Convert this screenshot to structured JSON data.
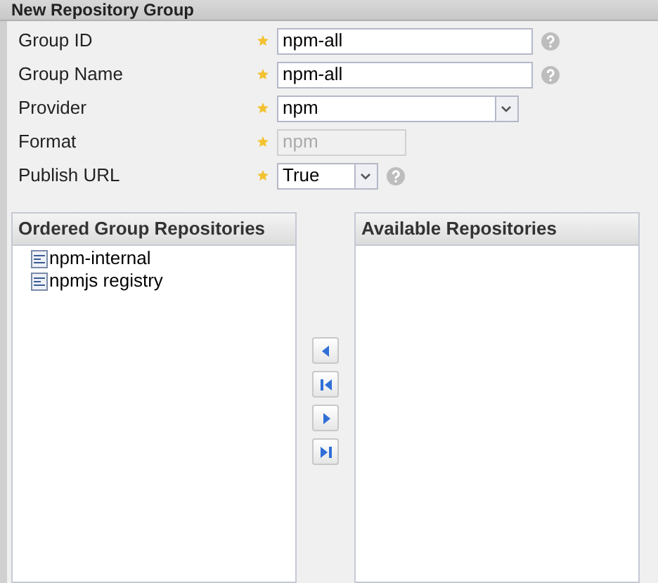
{
  "title": "New Repository Group",
  "fields": [
    {
      "label": "Group ID",
      "kind": "text",
      "value": "npm-all",
      "help": true,
      "disabled": false
    },
    {
      "label": "Group Name",
      "kind": "text",
      "value": "npm-all",
      "help": true,
      "disabled": false
    },
    {
      "label": "Provider",
      "kind": "select",
      "value": "npm",
      "help": false,
      "disabled": false
    },
    {
      "label": "Format",
      "kind": "text",
      "value": "npm",
      "help": false,
      "disabled": true
    },
    {
      "label": "Publish URL",
      "kind": "select",
      "value": "True",
      "help": true,
      "disabled": false
    }
  ],
  "ordered": {
    "title": "Ordered Group Repositories",
    "items": [
      "npm-internal",
      "npmjs registry"
    ]
  },
  "available": {
    "title": "Available Repositories"
  }
}
